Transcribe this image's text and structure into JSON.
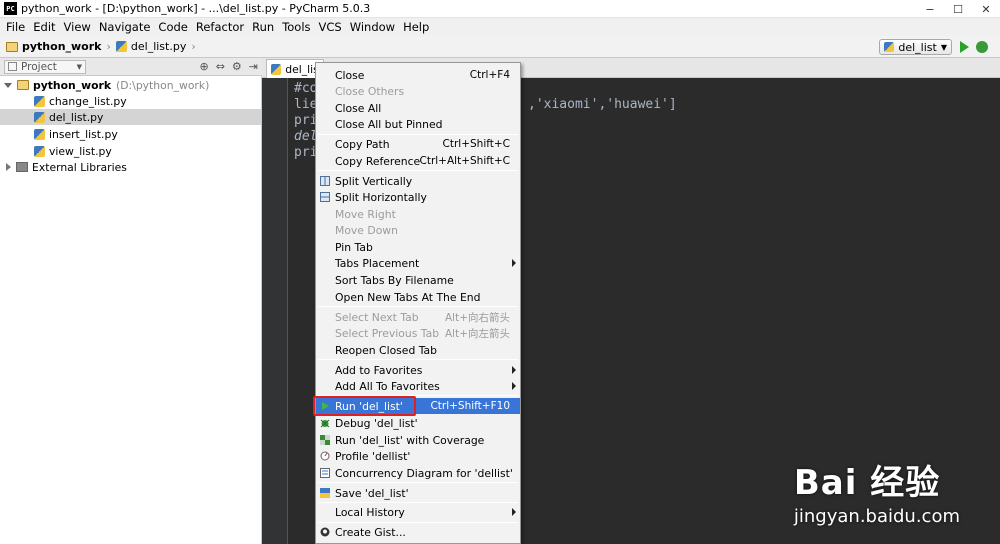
{
  "window": {
    "title": "python_work - [D:\\python_work] - ...\\del_list.py - PyCharm 5.0.3",
    "controls": [
      "−",
      "☐",
      "✕"
    ]
  },
  "menubar": [
    "File",
    "Edit",
    "View",
    "Navigate",
    "Code",
    "Refactor",
    "Run",
    "Tools",
    "VCS",
    "Window",
    "Help"
  ],
  "breadcrumb": {
    "project": "python_work",
    "file": "del_list.py"
  },
  "run_config": {
    "name": "del_list"
  },
  "project_panel": {
    "tab_label": "Project",
    "root": {
      "name": "python_work",
      "path": "(D:\\python_work)"
    },
    "files": [
      "change_list.py",
      "del_list.py",
      "insert_list.py",
      "view_list.py"
    ],
    "selected_file": "del_list.py",
    "libraries": "External Libraries"
  },
  "editor": {
    "tab_label": "del_list",
    "lines": [
      "#co",
      "lie",
      "pri",
      "del",
      "pri"
    ],
    "visible_code_fragment": ",'xiaomi','huawei']"
  },
  "context_menu": {
    "items": [
      {
        "label": "Close",
        "shortcut": "Ctrl+F4",
        "disabled": false
      },
      {
        "label": "Close Others",
        "shortcut": "",
        "disabled": true
      },
      {
        "label": "Close All",
        "shortcut": "",
        "disabled": false
      },
      {
        "label": "Close All but Pinned",
        "shortcut": "",
        "disabled": false
      },
      {
        "label": "Copy Path",
        "shortcut": "Ctrl+Shift+C",
        "disabled": false
      },
      {
        "label": "Copy Reference",
        "shortcut": "Ctrl+Alt+Shift+C",
        "disabled": false
      },
      {
        "label": "Split Vertically",
        "shortcut": "",
        "disabled": false
      },
      {
        "label": "Split Horizontally",
        "shortcut": "",
        "disabled": false
      },
      {
        "label": "Move Right",
        "shortcut": "",
        "disabled": true
      },
      {
        "label": "Move Down",
        "shortcut": "",
        "disabled": true
      },
      {
        "label": "Pin Tab",
        "shortcut": "",
        "disabled": false
      },
      {
        "label": "Tabs Placement",
        "shortcut": "",
        "disabled": false
      },
      {
        "label": "Sort Tabs By Filename",
        "shortcut": "",
        "disabled": false
      },
      {
        "label": "Open New Tabs At The End",
        "shortcut": "",
        "disabled": false
      },
      {
        "label": "Select Next Tab",
        "shortcut": "Alt+向右箭头",
        "disabled": true
      },
      {
        "label": "Select Previous Tab",
        "shortcut": "Alt+向左箭头",
        "disabled": true
      },
      {
        "label": "Reopen Closed Tab",
        "shortcut": "",
        "disabled": false
      },
      {
        "label": "Add to Favorites",
        "shortcut": "",
        "disabled": false
      },
      {
        "label": "Add All To Favorites",
        "shortcut": "",
        "disabled": false
      },
      {
        "label": "Run 'del_list'",
        "shortcut": "Ctrl+Shift+F10",
        "disabled": false,
        "highlighted": true
      },
      {
        "label": "Debug 'del_list'",
        "shortcut": "",
        "disabled": false
      },
      {
        "label": "Run 'del_list' with Coverage",
        "shortcut": "",
        "disabled": false
      },
      {
        "label": "Profile 'dellist'",
        "shortcut": "",
        "disabled": false
      },
      {
        "label": "Concurrency Diagram for  'dellist'",
        "shortcut": "",
        "disabled": false
      },
      {
        "label": "Save 'del_list'",
        "shortcut": "",
        "disabled": false
      },
      {
        "label": "Local History",
        "shortcut": "",
        "disabled": false
      },
      {
        "label": "Create Gist...",
        "shortcut": "",
        "disabled": false
      }
    ]
  },
  "watermark": {
    "brand": "Bai 经验",
    "url": "jingyan.baidu.com"
  },
  "colors": {
    "menu_highlight": "#3875d7",
    "editor_bg": "#2b2b2b",
    "annotation": "#e02020"
  }
}
